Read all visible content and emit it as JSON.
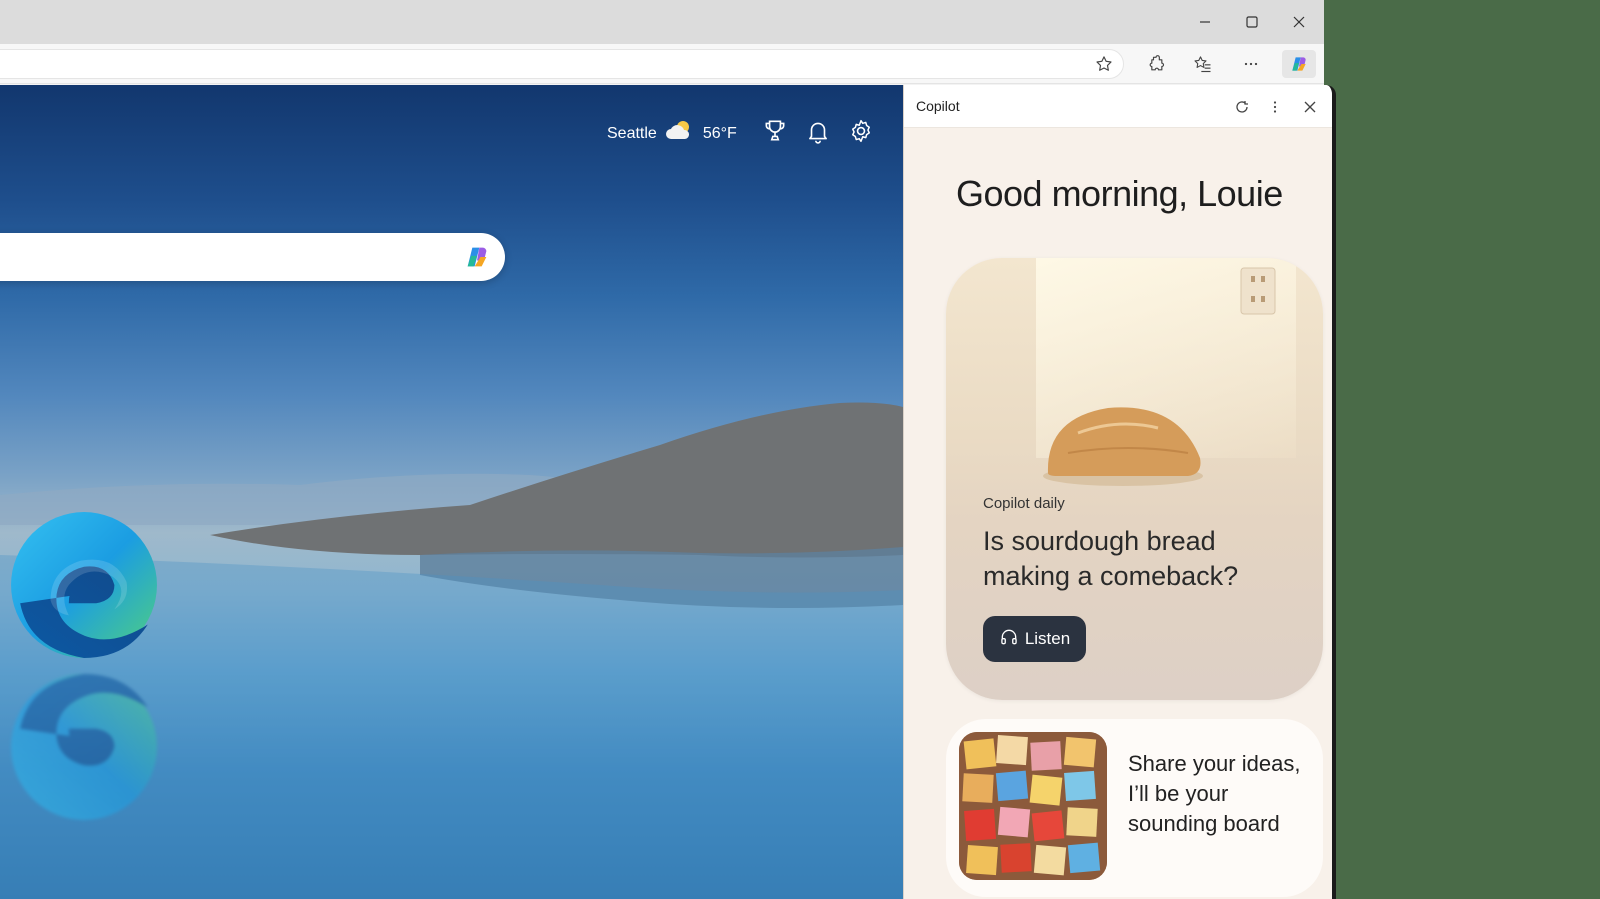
{
  "browser": {
    "window_controls": {
      "minimize": "minimize-icon",
      "maximize": "maximize-icon",
      "close": "close-icon"
    },
    "toolbar_icons": [
      "favorite-star-icon",
      "extensions-icon",
      "favorites-icon",
      "more-icon",
      "copilot-icon"
    ]
  },
  "newtab": {
    "weather": {
      "city": "Seattle",
      "temp": "56°F",
      "icon": "partly-cloudy-icon"
    },
    "header_icons": [
      "rewards-trophy-icon",
      "notifications-bell-icon",
      "settings-gear-icon"
    ]
  },
  "copilot": {
    "title": "Copilot",
    "header_icons": [
      "refresh-icon",
      "more-vertical-icon",
      "close-icon"
    ],
    "greeting": "Good morning, Louie",
    "daily": {
      "label": "Copilot daily",
      "title": "Is sourdough bread making a comeback?",
      "listen_label": "Listen"
    },
    "idea_card": {
      "text": "Share your ideas, I’ll be your sounding board"
    }
  }
}
